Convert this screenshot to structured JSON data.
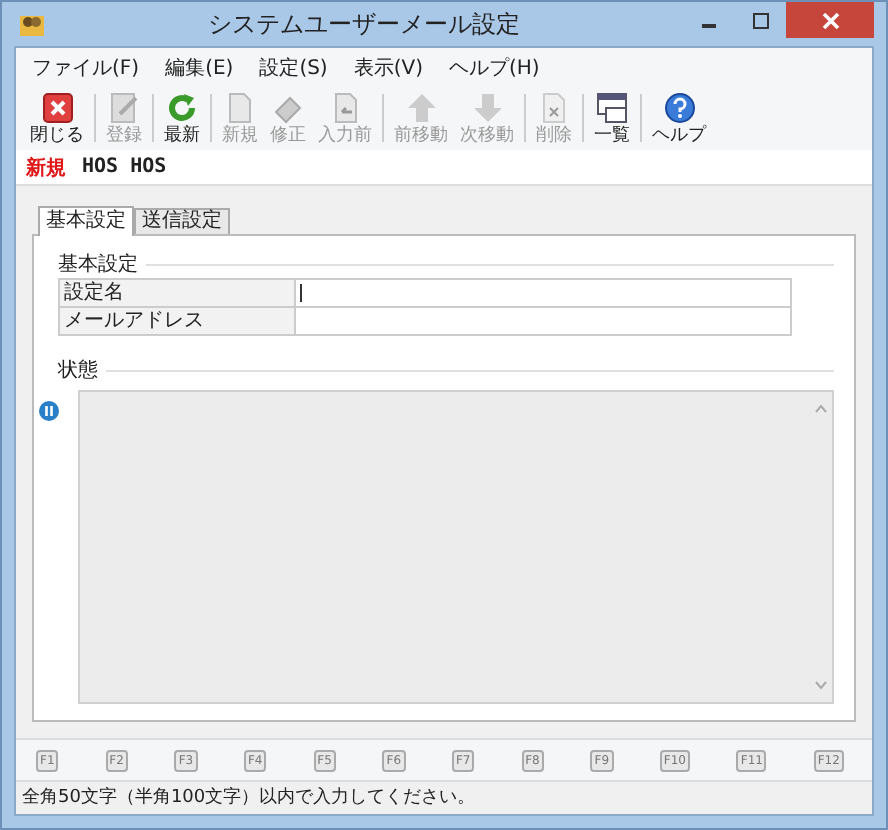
{
  "window": {
    "title": "システムユーザーメール設定"
  },
  "menu": [
    "ファイル(F)",
    "編集(E)",
    "設定(S)",
    "表示(V)",
    "ヘルプ(H)"
  ],
  "toolbar": [
    [
      {
        "kind": "close",
        "label": "閉じる",
        "disabled": false
      }
    ],
    [
      {
        "kind": "register",
        "label": "登録",
        "disabled": true
      }
    ],
    [
      {
        "kind": "refresh",
        "label": "最新",
        "disabled": false
      }
    ],
    [
      {
        "kind": "new",
        "label": "新規",
        "disabled": true
      },
      {
        "kind": "edit",
        "label": "修正",
        "disabled": true
      },
      {
        "kind": "undo",
        "label": "入力前",
        "disabled": true
      }
    ],
    [
      {
        "kind": "up",
        "label": "前移動",
        "disabled": true
      },
      {
        "kind": "down",
        "label": "次移動",
        "disabled": true
      }
    ],
    [
      {
        "kind": "delete",
        "label": "削除",
        "disabled": true
      }
    ],
    [
      {
        "kind": "list",
        "label": "一覧",
        "disabled": false
      }
    ],
    [
      {
        "kind": "help",
        "label": "ヘルプ",
        "disabled": false
      }
    ]
  ],
  "mode": {
    "status": "新規",
    "record": "HOS HOS"
  },
  "tabs": [
    {
      "label": "基本設定",
      "selected": true
    },
    {
      "label": "送信設定",
      "selected": false
    }
  ],
  "basic_section": {
    "title": "基本設定",
    "fields": [
      {
        "label": "設定名",
        "focused": true
      },
      {
        "label": "メールアドレス",
        "focused": false
      }
    ]
  },
  "status_section": {
    "title": "状態"
  },
  "function_keys": [
    "F1",
    "F2",
    "F3",
    "F4",
    "F5",
    "F6",
    "F7",
    "F8",
    "F9",
    "F10",
    "F11",
    "F12"
  ],
  "status_bar": "全角50文字（半角100文字）以内で入力してください。"
}
